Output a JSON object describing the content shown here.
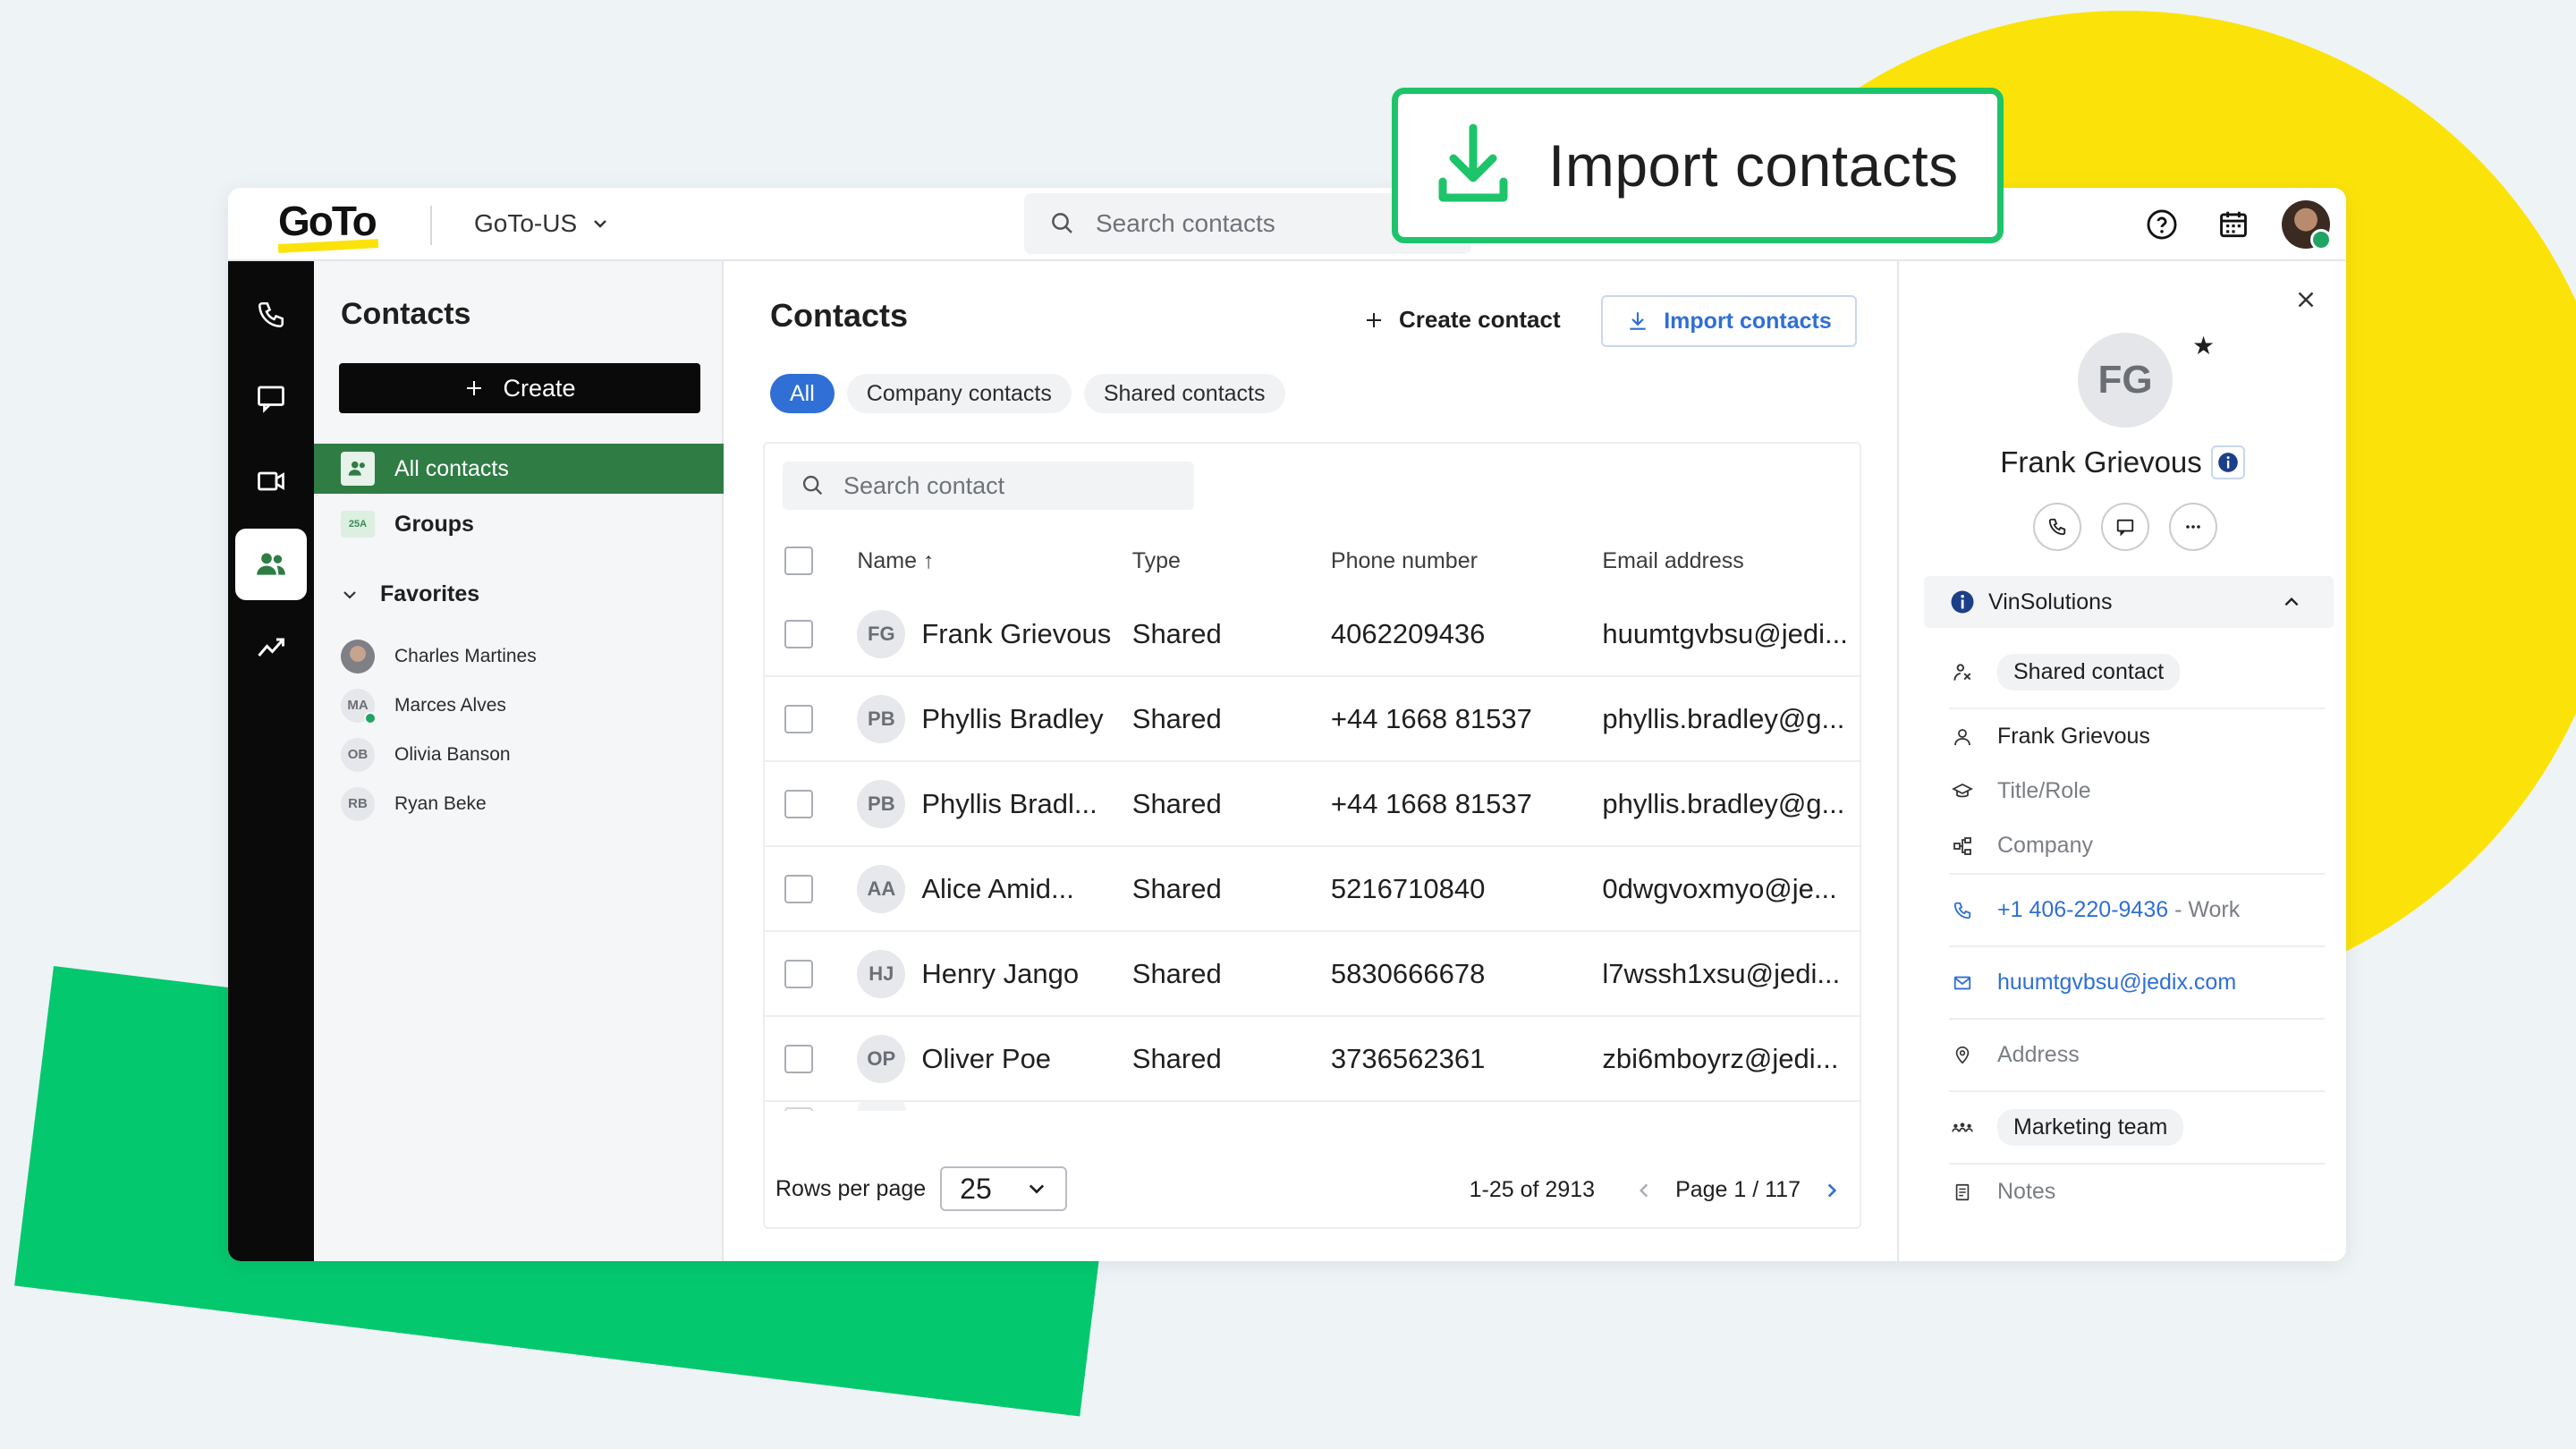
{
  "colors": {
    "accent_green": "#1dc46a",
    "brand_yellow": "#fbe30a",
    "link_blue": "#2f6fd6",
    "nav_active": "#2f7d44"
  },
  "callout": {
    "label": "Import contacts",
    "icon": "download-icon"
  },
  "topbar": {
    "logo": "GoTo",
    "account": "GoTo-US",
    "search_placeholder": "Search contacts",
    "icons": [
      "help-icon",
      "calendar-icon",
      "user-avatar"
    ]
  },
  "rail": {
    "items": [
      "phone-icon",
      "chat-icon",
      "video-icon",
      "contacts-icon",
      "analytics-icon"
    ],
    "active": "contacts-icon"
  },
  "left_panel": {
    "title": "Contacts",
    "create_label": "Create",
    "nav": [
      {
        "label": "All contacts",
        "active": true
      },
      {
        "label": "Groups",
        "badge": "25A"
      }
    ],
    "favorites_label": "Favorites",
    "favorites": [
      {
        "name": "Charles Martines",
        "initials": ""
      },
      {
        "name": "Marces Alves",
        "initials": "MA"
      },
      {
        "name": "Olivia Banson",
        "initials": "OB"
      },
      {
        "name": "Ryan Beke",
        "initials": "RB"
      }
    ]
  },
  "main": {
    "title": "Contacts",
    "create_contact_label": "Create contact",
    "import_label": "Import contacts",
    "filters": [
      {
        "label": "All",
        "active": true
      },
      {
        "label": "Company contacts"
      },
      {
        "label": "Shared contacts"
      }
    ],
    "search_placeholder": "Search contact",
    "columns": [
      "Name ↑",
      "Type",
      "Phone number",
      "Email address"
    ],
    "rows": [
      {
        "initials": "FG",
        "name": "Frank Grievous",
        "type": "Shared",
        "phone": "4062209436",
        "email": "huumtgvbsu@jedi..."
      },
      {
        "initials": "PB",
        "name": "Phyllis Bradley",
        "type": "Shared",
        "phone": "+44 1668 81537",
        "email": "phyllis.bradley@g..."
      },
      {
        "initials": "PB",
        "name": "Phyllis Bradl...",
        "type": "Shared",
        "phone": "+44 1668 81537",
        "email": "phyllis.bradley@g..."
      },
      {
        "initials": "AA",
        "name": "Alice Amid...",
        "type": "Shared",
        "phone": "5216710840",
        "email": "0dwgvoxmyo@je..."
      },
      {
        "initials": "HJ",
        "name": "Henry Jango",
        "type": "Shared",
        "phone": "5830666678",
        "email": "l7wssh1xsu@jedi..."
      },
      {
        "initials": "OP",
        "name": "Oliver Poe",
        "type": "Shared",
        "phone": "3736562361",
        "email": "zbi6mboyrz@jedi..."
      }
    ],
    "footer": {
      "rows_per_page_label": "Rows per page",
      "rows_per_page": "25",
      "range": "1-25 of 2913",
      "page": "Page 1 / 117"
    }
  },
  "right_panel": {
    "initials": "FG",
    "name": "Frank Grievous",
    "section_label": "VinSolutions",
    "shared_label": "Shared contact",
    "full_name": "Frank Grievous",
    "title_placeholder": "Title/Role",
    "company_placeholder": "Company",
    "phone": "+1 406-220-9436",
    "phone_type": "- Work",
    "email": "huumtgvbsu@jedix.com",
    "address_placeholder": "Address",
    "group": "Marketing team",
    "notes_placeholder": "Notes"
  }
}
